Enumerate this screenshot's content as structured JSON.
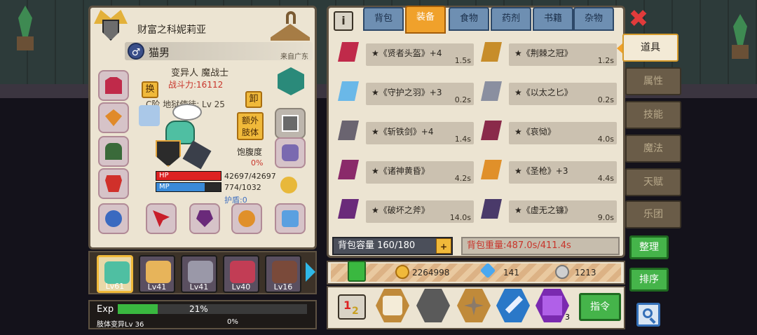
{
  "character": {
    "title": "财富之科妮莉亚",
    "gender_symbol": "♂",
    "name": "猫男",
    "origin": "来自广东",
    "class": "变异人 魔战士",
    "power": "战斗力:16112",
    "job": "C阶 地狱使徒: Lv 25",
    "swap_label": "换",
    "unequip_label": "卸",
    "extra_limb_label": "额外肢体",
    "satiety_label": "饱腹度",
    "satiety_value": "0%",
    "hp_label": "HP",
    "hp_value": "42697/42697",
    "hp_fraction": 1.0,
    "mp_label": "MP",
    "mp_value": "774/1032",
    "mp_fraction": 0.75,
    "shield": "护盾:0"
  },
  "roster": [
    {
      "level": "Lv61",
      "color": "#4fbfa2",
      "selected": true
    },
    {
      "level": "Lv41",
      "color": "#e7b45a",
      "selected": false
    },
    {
      "level": "Lv41",
      "color": "#9a98a8",
      "selected": false
    },
    {
      "level": "Lv40",
      "color": "#c23d55",
      "selected": false
    },
    {
      "level": "Lv16",
      "color": "#7a4a3a",
      "selected": false
    }
  ],
  "exp": {
    "label": "Exp",
    "percent": "21%",
    "fraction": 0.21,
    "sub_label": "肢体变异Lv 36",
    "sub_percent": "0%"
  },
  "inventory": {
    "info_label": "i",
    "tabs": [
      "背包",
      "装备",
      "食物",
      "药剂",
      "书籍",
      "杂物"
    ],
    "active_tab": "装备",
    "items": [
      {
        "name": "★《贤者头盔》+4",
        "weight": "1.5s",
        "color": "#c02a4a",
        "icon": "helmet-icon"
      },
      {
        "name": "★《荆棘之冠》",
        "weight": "1.2s",
        "color": "#c78d2a",
        "icon": "crown-icon"
      },
      {
        "name": "★《守护之羽》+3",
        "weight": "0.2s",
        "color": "#6ab8e8",
        "icon": "feather-icon"
      },
      {
        "name": "★《以太之匕》",
        "weight": "0.2s",
        "color": "#8a8fa0",
        "icon": "dagger-icon"
      },
      {
        "name": "★《斩铁剑》+4",
        "weight": "1.4s",
        "color": "#6a6470",
        "icon": "sword-icon"
      },
      {
        "name": "★《哀恸》",
        "weight": "4.0s",
        "color": "#8a2a4a",
        "icon": "blade-icon"
      },
      {
        "name": "★《诸神黄昏》",
        "weight": "4.2s",
        "color": "#8a2a6a",
        "icon": "greatsword-icon"
      },
      {
        "name": "★《圣枪》+3",
        "weight": "4.4s",
        "color": "#e0902a",
        "icon": "spear-icon"
      },
      {
        "name": "★《破坏之斧》",
        "weight": "14.0s",
        "color": "#6a2a7a",
        "icon": "axe-icon"
      },
      {
        "name": "★《虚无之镰》",
        "weight": "9.0s",
        "color": "#4a3a6a",
        "icon": "scythe-icon"
      }
    ],
    "capacity": "背包容量 160/180",
    "capacity_plus": "+",
    "weight": "背包重量:487.0s/411.4s"
  },
  "resources": {
    "gold": "2264998",
    "diamond": "141",
    "silver": "1213"
  },
  "actions": {
    "command_label": "指令",
    "badge_count": "3"
  },
  "side_tabs": [
    "道具",
    "属性",
    "技能",
    "魔法",
    "天赋",
    "乐团"
  ],
  "active_side_tab": "道具",
  "buttons": {
    "organize": "整理",
    "sort": "排序",
    "close": "✖"
  }
}
